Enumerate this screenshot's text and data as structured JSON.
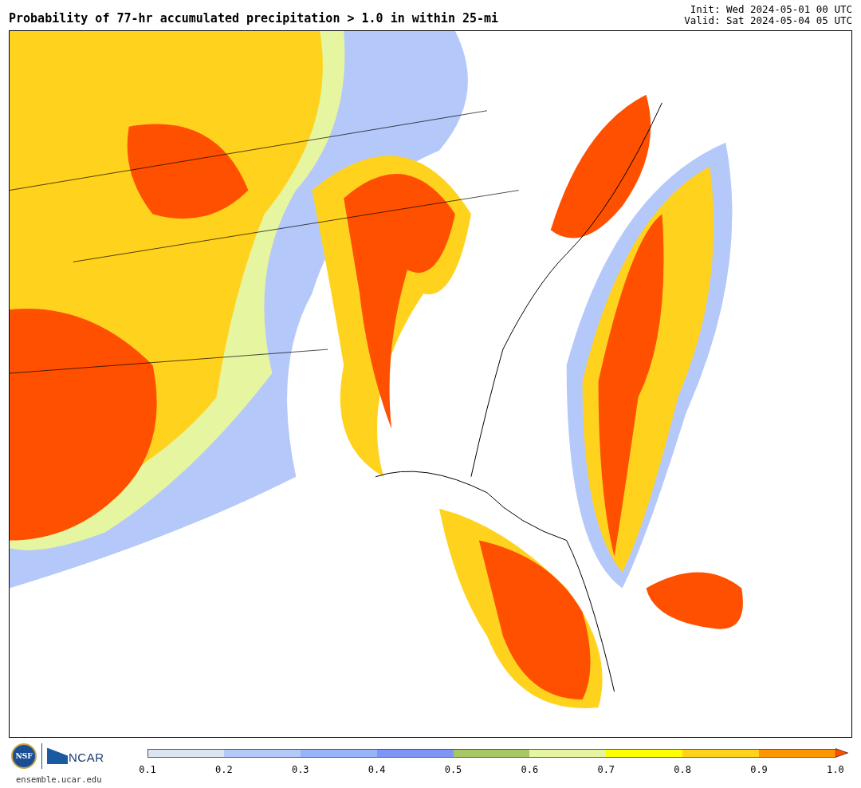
{
  "title": "Probability of 77-hr accumulated precipitation > 1.0 in within 25-mi",
  "init": "Init: Wed 2024-05-01 00 UTC",
  "valid": "Valid: Sat 2024-05-04 05 UTC",
  "logos": {
    "nsf": "NSF",
    "ncar": "NCAR"
  },
  "site": "ensemble.ucar.edu",
  "colorbar": {
    "segments": [
      {
        "kind": "box",
        "color": "#dce6f0"
      },
      {
        "kind": "box",
        "color": "#b4c8fa"
      },
      {
        "kind": "box",
        "color": "#96b4f8"
      },
      {
        "kind": "box",
        "color": "#7d96f5"
      },
      {
        "kind": "box",
        "color": "#a5c864"
      },
      {
        "kind": "box",
        "color": "#e6f5a0"
      },
      {
        "kind": "box",
        "color": "#ffff00"
      },
      {
        "kind": "box",
        "color": "#ffd21e"
      },
      {
        "kind": "box",
        "color": "#ff9600"
      },
      {
        "kind": "arrow",
        "color": "#ff5000"
      }
    ],
    "ticks": [
      "0.1",
      "0.2",
      "0.3",
      "0.4",
      "0.5",
      "0.6",
      "0.7",
      "0.8",
      "0.9",
      "1.0"
    ]
  }
}
